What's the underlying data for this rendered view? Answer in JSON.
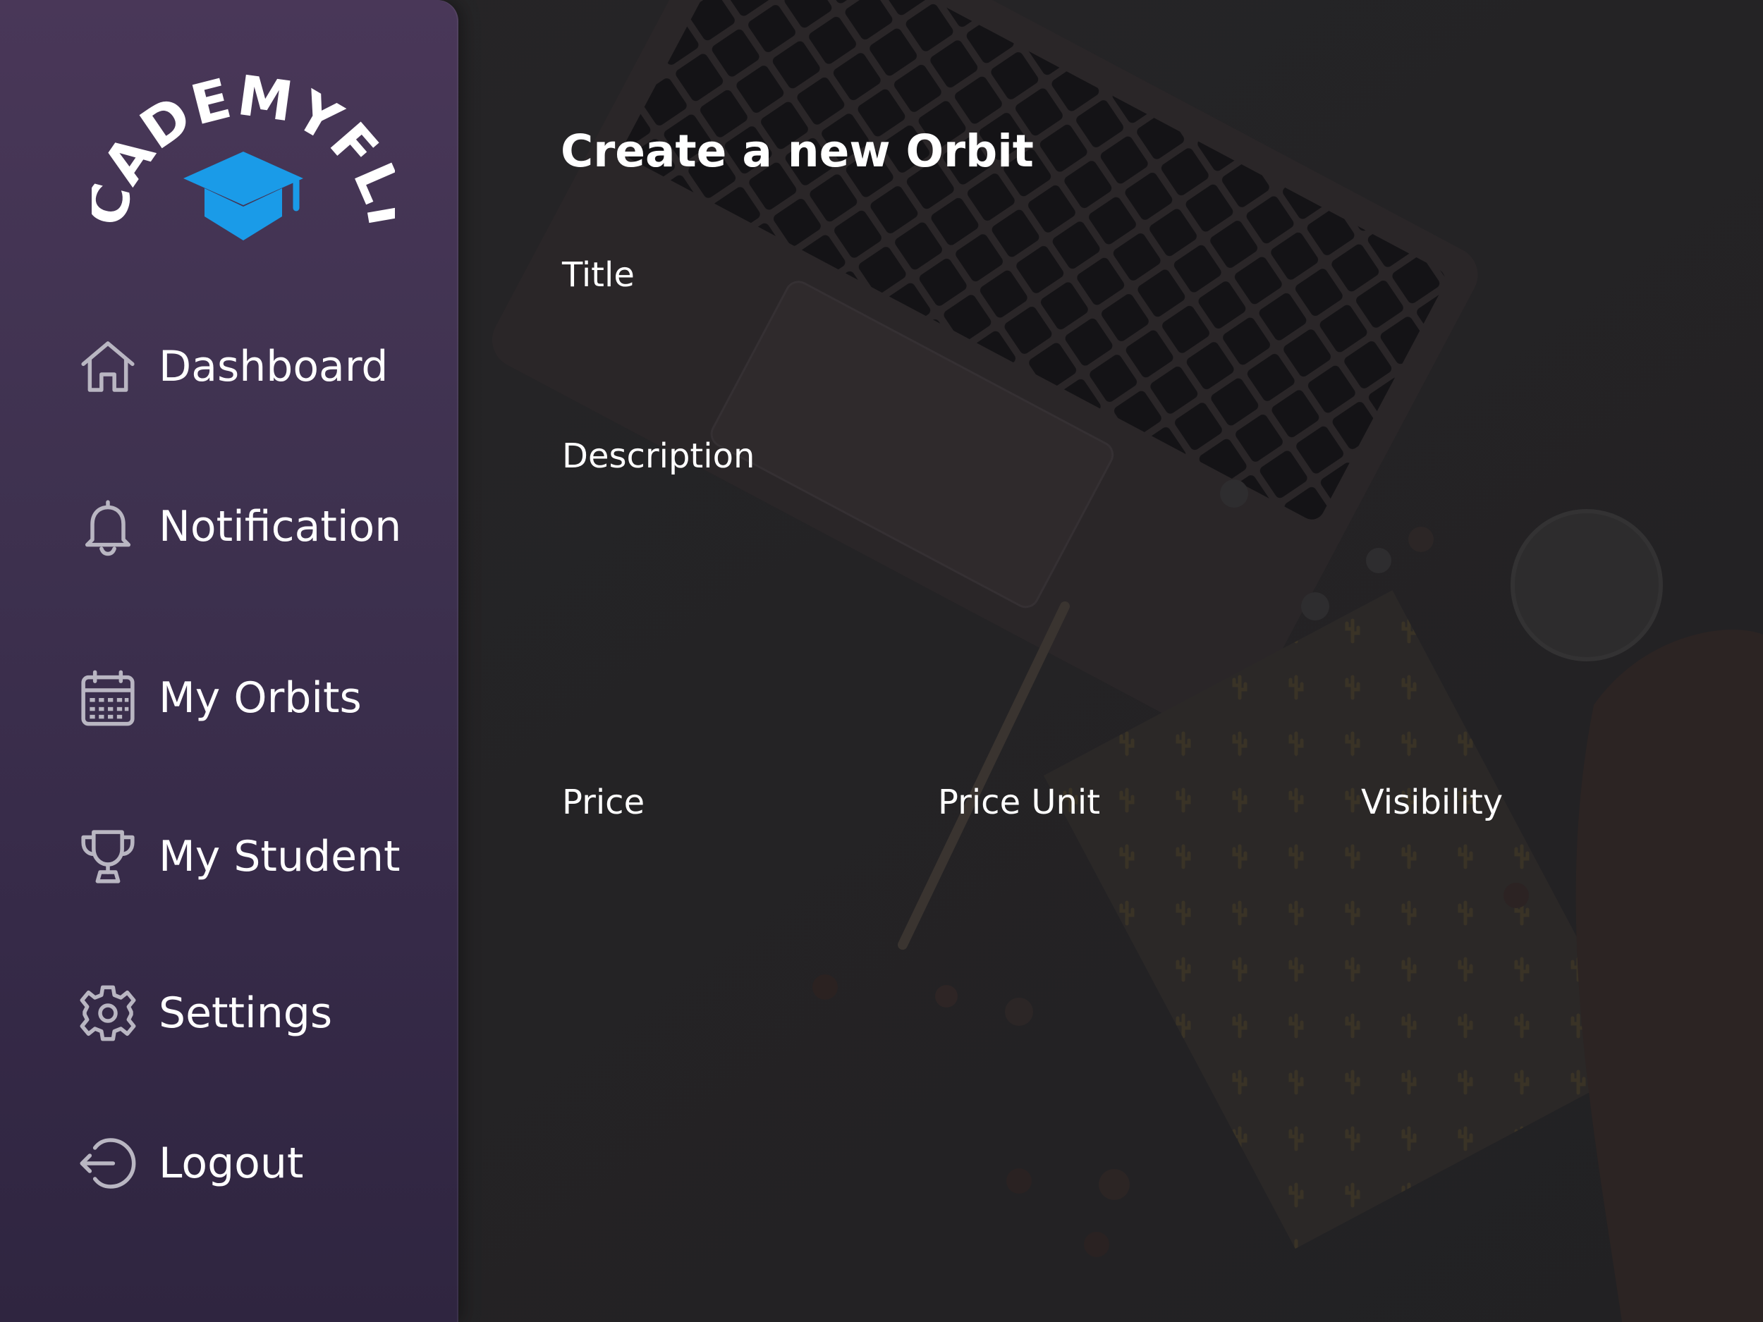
{
  "app": {
    "brand_name": "ACADEMYFLIX",
    "brand_color": "#1a9be8"
  },
  "sidebar": {
    "items": [
      {
        "label": "Dashboard",
        "icon": "home-icon"
      },
      {
        "label": "Notification",
        "icon": "bell-icon"
      },
      {
        "label": "My Orbits",
        "icon": "calendar-icon"
      },
      {
        "label": "My Student",
        "icon": "trophy-icon"
      },
      {
        "label": "Settings",
        "icon": "gear-icon"
      },
      {
        "label": "Logout",
        "icon": "logout-icon"
      }
    ]
  },
  "form": {
    "title": "Create a new Orbit",
    "fields": {
      "title": {
        "label": "Title",
        "value": ""
      },
      "description": {
        "label": "Description",
        "value": ""
      },
      "price": {
        "label": "Price",
        "value": ""
      },
      "price_unit": {
        "label": "Price Unit",
        "value": ""
      },
      "visibility": {
        "label": "Visibility",
        "value": ""
      }
    }
  }
}
